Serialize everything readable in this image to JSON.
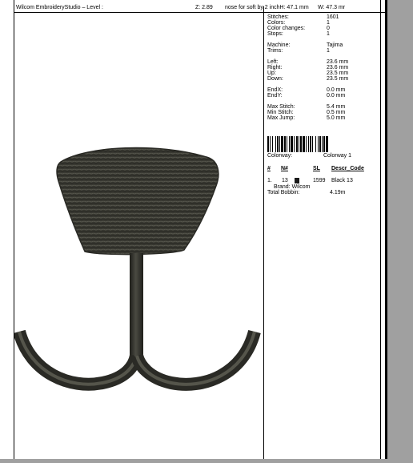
{
  "header": {
    "app_title": "Wilcom EmbroideryStudio – Level :",
    "zoom": "Z: 2.89",
    "file_info": "nose for soft by 2 inchH: 47.1 mm",
    "width": "W: 47.3 mr"
  },
  "stats": {
    "stitches": {
      "label": "Stitches:",
      "value": "1601"
    },
    "colors": {
      "label": "Colors:",
      "value": "1"
    },
    "color_changes": {
      "label": "Color changes:",
      "value": "0"
    },
    "stops": {
      "label": "Stops:",
      "value": "1"
    },
    "machine": {
      "label": "Machine:",
      "value": "Tajima"
    },
    "trims": {
      "label": "Trims:",
      "value": "1"
    },
    "left": {
      "label": "Left:",
      "value": "23.6 mm"
    },
    "right": {
      "label": "Right:",
      "value": "23.6 mm"
    },
    "up": {
      "label": "Up:",
      "value": "23.5 mm"
    },
    "down": {
      "label": "Down:",
      "value": "23.5 mm"
    },
    "endx": {
      "label": "EndX:",
      "value": "0.0 mm"
    },
    "endy": {
      "label": "EndY:",
      "value": "0.0 mm"
    },
    "max_stitch": {
      "label": "Max Stitch:",
      "value": "5.4 mm"
    },
    "min_stitch": {
      "label": "Min Stitch:",
      "value": "0.5 mm"
    },
    "max_jump": {
      "label": "Max Jump:",
      "value": "5.0 mm"
    }
  },
  "colorway": {
    "label": "Colorway:",
    "name": "Colorway 1"
  },
  "table": {
    "headers": {
      "num": "#",
      "n": "N#",
      "sl": "SL",
      "desc": "Descr_Code"
    },
    "rows": [
      {
        "num": "1.",
        "n": "13",
        "swatch_color": "#1a1a1a",
        "sl": "1599",
        "desc": "Black 13"
      }
    ],
    "brand": "Brand: Wilcom",
    "total_bobbin_label": "Total Bobbin:",
    "total_bobbin_value": "4.19m"
  },
  "colors": {
    "thread": "#3a3a33",
    "thread_dark": "#1f1f1b",
    "thread_light": "#6c6c62"
  }
}
